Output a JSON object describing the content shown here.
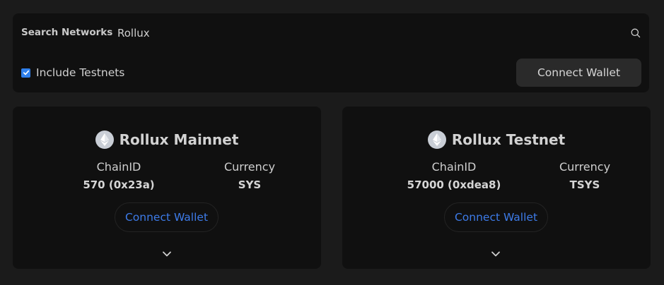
{
  "search": {
    "label": "Search Networks",
    "value": "Rollux",
    "icon": "search-icon"
  },
  "testnets": {
    "label": "Include Testnets",
    "checked": true
  },
  "top_connect_label": "Connect Wallet",
  "colors": {
    "background": "#1b1b1b",
    "panel": "#101010",
    "accent": "#3d7be8",
    "checkbox": "#2f80ed"
  },
  "networks": [
    {
      "name": "Rollux Mainnet",
      "icon": "ethereum-icon",
      "chain_id_label": "ChainID",
      "chain_id": "570 (0x23a)",
      "currency_label": "Currency",
      "currency": "SYS",
      "connect_label": "Connect Wallet"
    },
    {
      "name": "Rollux Testnet",
      "icon": "ethereum-icon",
      "chain_id_label": "ChainID",
      "chain_id": "57000 (0xdea8)",
      "currency_label": "Currency",
      "currency": "TSYS",
      "connect_label": "Connect Wallet"
    }
  ]
}
